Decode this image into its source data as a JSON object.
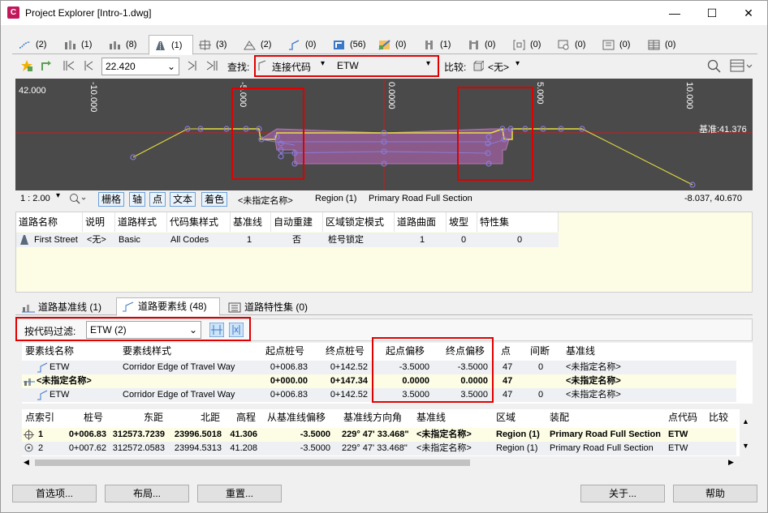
{
  "window": {
    "title": "Project Explorer [Intro-1.dwg]",
    "app_icon": "C",
    "minimize": "—",
    "maximize": "☐",
    "close": "✕"
  },
  "top_tabs": [
    {
      "icon": "alignment-icon",
      "count": "(2)"
    },
    {
      "icon": "profile-icon",
      "count": "(1)"
    },
    {
      "icon": "profile-view-icon",
      "count": "(8)"
    },
    {
      "icon": "corridor-icon",
      "count": "(1)"
    },
    {
      "icon": "assembly-icon",
      "count": "(3)"
    },
    {
      "icon": "surface-icon",
      "count": "(2)"
    },
    {
      "icon": "feature-line-icon",
      "count": "(0)"
    },
    {
      "icon": "sample-line-icon",
      "count": "(56)"
    },
    {
      "icon": "section-view-icon",
      "count": "(0)"
    },
    {
      "icon": "pipe-network-icon",
      "count": "(1)"
    },
    {
      "icon": "pressure-network-icon",
      "count": "(0)"
    },
    {
      "icon": "parcel-icon",
      "count": "(0)"
    },
    {
      "icon": "point-group-icon",
      "count": "(0)"
    },
    {
      "icon": "view-frame-icon",
      "count": "(0)"
    },
    {
      "icon": "table-icon",
      "count": "(0)"
    }
  ],
  "toolbar": {
    "station_value": "22.420",
    "find_label": "查找:",
    "find_type": "连接代码",
    "find_code": "ETW",
    "compare_label": "比较:",
    "compare_value": "<无>"
  },
  "viewer": {
    "elev_label": "42.000",
    "offsets": [
      "-10.000",
      "-5.000",
      "0.0000",
      "5.000",
      "10.000"
    ],
    "baseline_label": "基准:41.376"
  },
  "status": {
    "scale": "1 : 2.00",
    "buttons": [
      "栅格",
      "轴",
      "点",
      "文本",
      "着色"
    ],
    "baseline": "<未指定名称>",
    "region": "Region (1)",
    "assembly": "Primary Road Full Section",
    "coords": "-8.037, 40.670"
  },
  "corridor_grid": {
    "headers": [
      "道路名称",
      "说明",
      "道路样式",
      "代码集样式",
      "基准线",
      "自动重建",
      "区域锁定模式",
      "道路曲面",
      "坡型",
      "特性集"
    ],
    "row": [
      "First Street",
      "<无>",
      "Basic",
      "All Codes",
      "1",
      "否",
      "桩号锁定",
      "1",
      "0",
      "0"
    ]
  },
  "bottom_tabs": [
    {
      "label": "道路基准线 (1)",
      "icon": "baseline-icon"
    },
    {
      "label": "道路要素线 (48)",
      "icon": "feature-line-icon"
    },
    {
      "label": "道路特性集 (0)",
      "icon": "property-set-icon"
    }
  ],
  "filter": {
    "label": "按代码过滤:",
    "value": "ETW  (2)"
  },
  "feature_grid": {
    "headers": [
      "要素线名称",
      "要素线样式",
      "起点桩号",
      "终点桩号",
      "起点偏移",
      "终点偏移",
      "点",
      "间断",
      "基准线"
    ],
    "rows": [
      [
        "ETW",
        "Corridor Edge of Travel Way",
        "0+006.83",
        "0+142.52",
        "-3.5000",
        "-3.5000",
        "47",
        "0",
        "<未指定名称>"
      ],
      [
        "<未指定名称>",
        "",
        "0+000.00",
        "0+147.34",
        "0.0000",
        "0.0000",
        "47",
        "",
        "<未指定名称>"
      ],
      [
        "ETW",
        "Corridor Edge of Travel Way",
        "0+006.83",
        "0+142.52",
        "3.5000",
        "3.5000",
        "47",
        "0",
        "<未指定名称>"
      ]
    ]
  },
  "point_grid": {
    "headers": [
      "点索引",
      "桩号",
      "东距",
      "北距",
      "高程",
      "从基准线偏移",
      "基准线方向角",
      "基准线",
      "区域",
      "装配",
      "点代码",
      "比较"
    ],
    "rows": [
      [
        "1",
        "0+006.83",
        "312573.7239",
        "23996.5018",
        "41.306",
        "-3.5000",
        "229° 47' 33.468\"",
        "<未指定名称>",
        "Region (1)",
        "Primary Road Full Section",
        "ETW"
      ],
      [
        "2",
        "0+007.62",
        "312572.0583",
        "23994.5313",
        "41.208",
        "-3.5000",
        "229° 47' 33.468\"",
        "<未指定名称>",
        "Region (1)",
        "Primary Road Full Section",
        "ETW"
      ]
    ]
  },
  "footer_buttons": {
    "preferences": "首选项...",
    "layout": "布局...",
    "reset": "重置...",
    "about": "关于...",
    "help": "帮助"
  },
  "colors": {
    "highlight_red": "#e00000",
    "accent_blue": "#3c78c8",
    "selected_row": "#fdfde6"
  }
}
